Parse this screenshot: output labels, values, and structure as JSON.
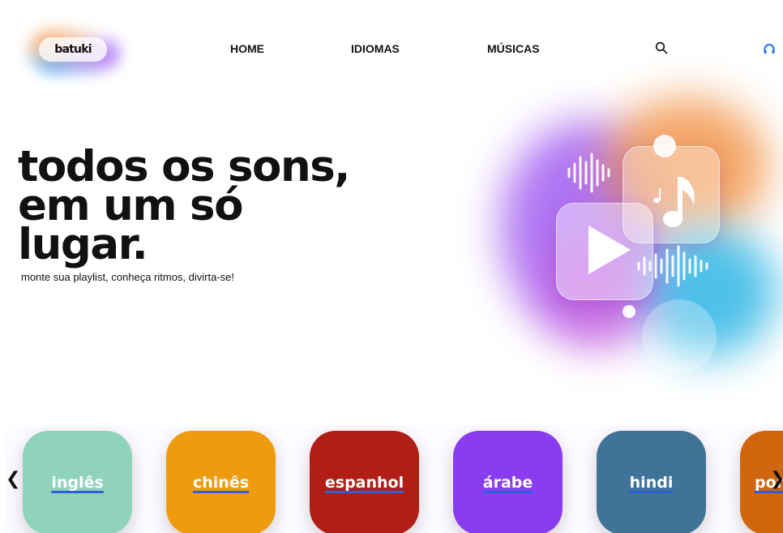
{
  "header": {
    "logo": "batuki",
    "nav": [
      {
        "label": "HOME"
      },
      {
        "label": "IDIOMAS"
      },
      {
        "label": "MÚSICAS"
      }
    ],
    "icons": [
      "search-icon",
      "headphones-icon"
    ]
  },
  "hero": {
    "title_lines": [
      "todos os sons,",
      "em um só",
      "lugar."
    ],
    "subtitle": "monte sua playlist, conheça ritmos, divirta-se!"
  },
  "carousel": {
    "prev": "❮",
    "next": "❯",
    "items": [
      {
        "label": "inglês",
        "color": "#8fd3bd"
      },
      {
        "label": "chinês",
        "color": "#ef9b10"
      },
      {
        "label": "espanhol",
        "color": "#b01e16"
      },
      {
        "label": "árabe",
        "color": "#8a3df0"
      },
      {
        "label": "hindi",
        "color": "#3f7397"
      },
      {
        "label": "por",
        "color": "#d0660e"
      }
    ]
  },
  "colors": {
    "accent_headphones": "#1a6ff0",
    "underline": "#2f5fd8"
  }
}
